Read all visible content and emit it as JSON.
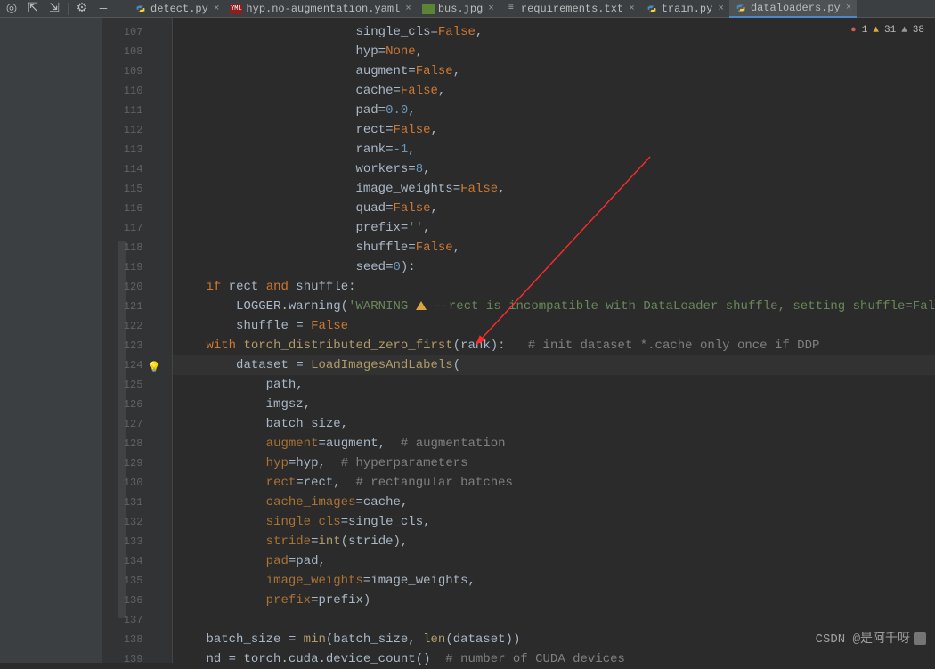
{
  "toolbar_icons": [
    "aim",
    "underline-up",
    "underline-down",
    "gear",
    "dash"
  ],
  "tabs": [
    {
      "icon": "py",
      "label": "detect.py",
      "active": false
    },
    {
      "icon": "yaml",
      "label": "hyp.no-augmentation.yaml",
      "active": false
    },
    {
      "icon": "jpg",
      "label": "bus.jpg",
      "active": false
    },
    {
      "icon": "txt",
      "label": "requirements.txt",
      "active": false
    },
    {
      "icon": "py",
      "label": "train.py",
      "active": false
    },
    {
      "icon": "py",
      "label": "dataloaders.py",
      "active": true
    }
  ],
  "inspections": {
    "errors": "1",
    "warnings": "31",
    "typos": "38"
  },
  "watermark": "CSDN @是阿千呀",
  "gutter_start": 107,
  "gutter_end": 139,
  "current_line": 124,
  "code": {
    "107": [
      [
        "plain",
        "                        single_cls="
      ],
      [
        "bool",
        "False"
      ],
      [
        "plain",
        ","
      ]
    ],
    "108": [
      [
        "plain",
        "                        hyp="
      ],
      [
        "none",
        "None"
      ],
      [
        "plain",
        ","
      ]
    ],
    "109": [
      [
        "plain",
        "                        augment="
      ],
      [
        "bool",
        "False"
      ],
      [
        "plain",
        ","
      ]
    ],
    "110": [
      [
        "plain",
        "                        cache="
      ],
      [
        "bool",
        "False"
      ],
      [
        "plain",
        ","
      ]
    ],
    "111": [
      [
        "plain",
        "                        pad="
      ],
      [
        "num",
        "0.0"
      ],
      [
        "plain",
        ","
      ]
    ],
    "112": [
      [
        "plain",
        "                        rect="
      ],
      [
        "bool",
        "False"
      ],
      [
        "plain",
        ","
      ]
    ],
    "113": [
      [
        "plain",
        "                        rank="
      ],
      [
        "num",
        "-1"
      ],
      [
        "plain",
        ","
      ]
    ],
    "114": [
      [
        "plain",
        "                        workers="
      ],
      [
        "num",
        "8"
      ],
      [
        "plain",
        ","
      ]
    ],
    "115": [
      [
        "plain",
        "                        image_weights="
      ],
      [
        "bool",
        "False"
      ],
      [
        "plain",
        ","
      ]
    ],
    "116": [
      [
        "plain",
        "                        quad="
      ],
      [
        "bool",
        "False"
      ],
      [
        "plain",
        ","
      ]
    ],
    "117": [
      [
        "plain",
        "                        prefix="
      ],
      [
        "str",
        "''"
      ],
      [
        "plain",
        ","
      ]
    ],
    "118": [
      [
        "plain",
        "                        shuffle="
      ],
      [
        "bool",
        "False"
      ],
      [
        "plain",
        ","
      ]
    ],
    "119": [
      [
        "plain",
        "                        seed="
      ],
      [
        "num",
        "0"
      ],
      [
        "plain",
        "):"
      ]
    ],
    "120": [
      [
        "plain",
        "    "
      ],
      [
        "kw",
        "if"
      ],
      [
        "plain",
        " rect "
      ],
      [
        "kw",
        "and"
      ],
      [
        "plain",
        " shuffle:"
      ]
    ],
    "121": [
      [
        "plain",
        "        LOGGER.warning("
      ],
      [
        "str",
        "'WARNING "
      ],
      [
        "warnicon",
        ""
      ],
      [
        "str",
        " --rect is incompatible with DataLoader shuffle, setting shuffle=Fal"
      ]
    ],
    "122": [
      [
        "plain",
        "        shuffle = "
      ],
      [
        "bool",
        "False"
      ]
    ],
    "123": [
      [
        "plain",
        "    "
      ],
      [
        "kw",
        "with"
      ],
      [
        "plain",
        " "
      ],
      [
        "call",
        "torch_distributed_zero_first"
      ],
      [
        "plain",
        "(rank):   "
      ],
      [
        "cmnt",
        "# init dataset *.cache only once if DDP"
      ]
    ],
    "124": [
      [
        "plain",
        "        dataset = "
      ],
      [
        "call",
        "LoadImagesAndLabels"
      ],
      [
        "plain",
        "("
      ]
    ],
    "125": [
      [
        "plain",
        "            path,"
      ]
    ],
    "126": [
      [
        "plain",
        "            imgsz,"
      ]
    ],
    "127": [
      [
        "plain",
        "            batch_size,"
      ]
    ],
    "128": [
      [
        "plain",
        "            "
      ],
      [
        "param",
        "augment"
      ],
      [
        "plain",
        "=augment,  "
      ],
      [
        "cmnt",
        "# augmentation"
      ]
    ],
    "129": [
      [
        "plain",
        "            "
      ],
      [
        "param",
        "hyp"
      ],
      [
        "plain",
        "=hyp,  "
      ],
      [
        "cmnt",
        "# hyperparameters"
      ]
    ],
    "130": [
      [
        "plain",
        "            "
      ],
      [
        "param",
        "rect"
      ],
      [
        "plain",
        "=rect,  "
      ],
      [
        "cmnt",
        "# rectangular batches"
      ]
    ],
    "131": [
      [
        "plain",
        "            "
      ],
      [
        "param",
        "cache_images"
      ],
      [
        "plain",
        "=cache,"
      ]
    ],
    "132": [
      [
        "plain",
        "            "
      ],
      [
        "param",
        "single_cls"
      ],
      [
        "plain",
        "=single_cls,"
      ]
    ],
    "133": [
      [
        "plain",
        "            "
      ],
      [
        "param",
        "stride"
      ],
      [
        "plain",
        "="
      ],
      [
        "call",
        "int"
      ],
      [
        "plain",
        "(stride),"
      ]
    ],
    "134": [
      [
        "plain",
        "            "
      ],
      [
        "param",
        "pad"
      ],
      [
        "plain",
        "=pad,"
      ]
    ],
    "135": [
      [
        "plain",
        "            "
      ],
      [
        "param",
        "image_weights"
      ],
      [
        "plain",
        "=image_weights,"
      ]
    ],
    "136": [
      [
        "plain",
        "            "
      ],
      [
        "param",
        "prefix"
      ],
      [
        "plain",
        "=prefix)"
      ]
    ],
    "137": [
      [
        "plain",
        ""
      ]
    ],
    "138": [
      [
        "plain",
        "    batch_size = "
      ],
      [
        "call",
        "min"
      ],
      [
        "plain",
        "(batch_size, "
      ],
      [
        "call",
        "len"
      ],
      [
        "plain",
        "(dataset))"
      ]
    ],
    "139": [
      [
        "plain",
        "    nd = torch.cuda.device_count()  "
      ],
      [
        "cmnt",
        "# number of CUDA devices"
      ]
    ]
  }
}
